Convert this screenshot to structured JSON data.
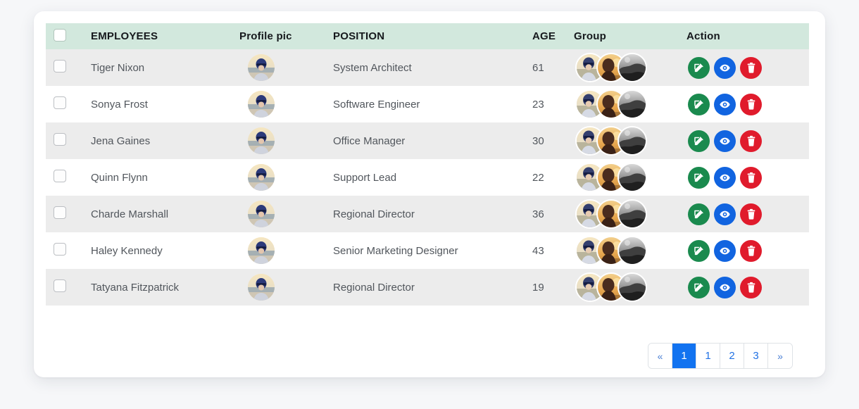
{
  "table": {
    "columns": [
      {
        "key": "select",
        "label": ""
      },
      {
        "key": "name",
        "label": "EMPLOYEES"
      },
      {
        "key": "pic",
        "label": "Profile pic"
      },
      {
        "key": "position",
        "label": "POSITION"
      },
      {
        "key": "age",
        "label": "AGE"
      },
      {
        "key": "group",
        "label": "Group"
      },
      {
        "key": "action",
        "label": "Action"
      }
    ],
    "rows": [
      {
        "name": "Tiger Nixon",
        "position": "System Architect",
        "age": "61"
      },
      {
        "name": "Sonya Frost",
        "position": "Software Engineer",
        "age": "23"
      },
      {
        "name": "Jena Gaines",
        "position": "Office Manager",
        "age": "30"
      },
      {
        "name": "Quinn Flynn",
        "position": "Support Lead",
        "age": "22"
      },
      {
        "name": "Charde Marshall",
        "position": "Regional Director",
        "age": "36"
      },
      {
        "name": "Haley Kennedy",
        "position": "Senior Marketing Designer",
        "age": "43"
      },
      {
        "name": "Tatyana Fitzpatrick",
        "position": "Regional Director",
        "age": "19"
      }
    ],
    "row_actions": [
      {
        "name": "edit-button",
        "icon": "edit-icon",
        "color": "#1a8a4e"
      },
      {
        "name": "view-button",
        "icon": "eye-icon",
        "color": "#1164e0"
      },
      {
        "name": "delete-button",
        "icon": "trash-icon",
        "color": "#e01b2c"
      }
    ],
    "group_avatar_count": 3,
    "header_bg": "#d2e8dd",
    "stripe_bg": "#ececec"
  },
  "pagination": {
    "items": [
      {
        "label": "«",
        "active": false,
        "type": "prev"
      },
      {
        "label": "1",
        "active": true,
        "type": "page"
      },
      {
        "label": "1",
        "active": false,
        "type": "page"
      },
      {
        "label": "2",
        "active": false,
        "type": "page"
      },
      {
        "label": "3",
        "active": false,
        "type": "page"
      },
      {
        "label": "»",
        "active": false,
        "type": "next"
      }
    ],
    "active_color": "#1273f0",
    "link_color": "#2272e4"
  }
}
